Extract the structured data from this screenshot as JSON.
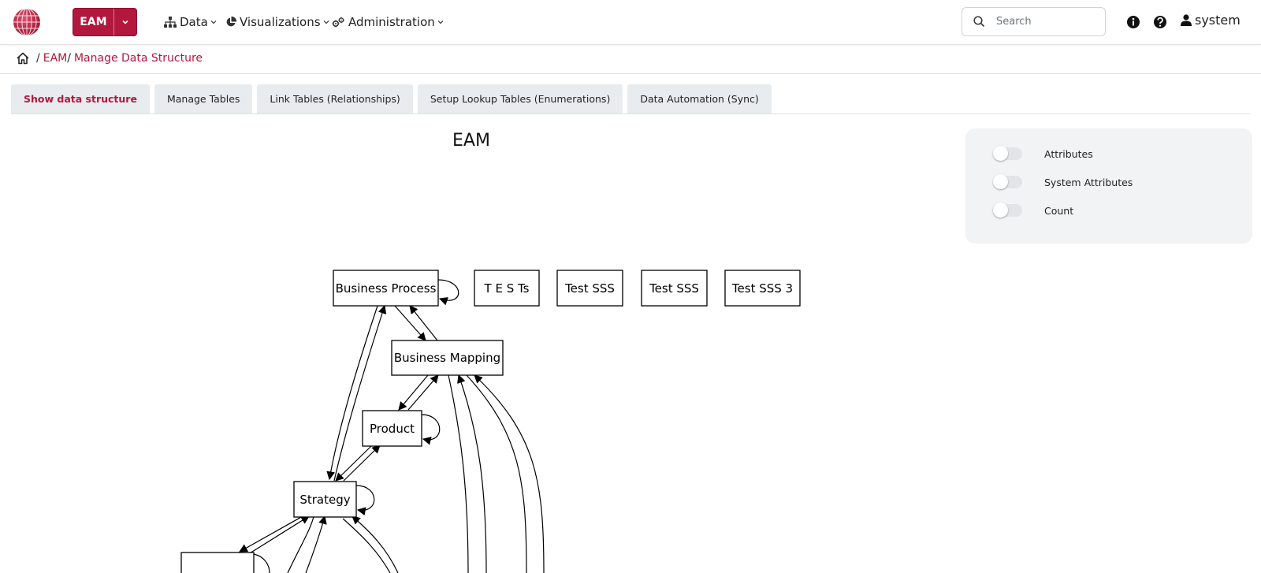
{
  "header": {
    "app_switcher_label": "EAM",
    "menus": [
      {
        "label": "Data"
      },
      {
        "label": "Visualizations"
      },
      {
        "label": "Administration"
      }
    ],
    "search_placeholder": "Search",
    "user_name": "system"
  },
  "breadcrumb": {
    "items": [
      "EAM",
      "Manage Data Structure"
    ]
  },
  "tabs": [
    {
      "label": "Show data structure",
      "active": true
    },
    {
      "label": "Manage Tables",
      "active": false
    },
    {
      "label": "Link Tables (Relationships)",
      "active": false
    },
    {
      "label": "Setup Lookup Tables (Enumerations)",
      "active": false
    },
    {
      "label": "Data Automation (Sync)",
      "active": false
    }
  ],
  "options_panel": {
    "toggles": [
      {
        "label": "Attributes",
        "on": false
      },
      {
        "label": "System Attributes",
        "on": false
      },
      {
        "label": "Count",
        "on": false
      }
    ]
  },
  "graph": {
    "title": "EAM",
    "nodes": [
      {
        "id": "bp",
        "label": "Business Process"
      },
      {
        "id": "tests",
        "label": "T E S Ts"
      },
      {
        "id": "sss1",
        "label": "Test SSS"
      },
      {
        "id": "sss2",
        "label": "Test SSS"
      },
      {
        "id": "sss3",
        "label": "Test SSS 3"
      },
      {
        "id": "bm",
        "label": "Business Mapping"
      },
      {
        "id": "prod",
        "label": "Product"
      },
      {
        "id": "strat",
        "label": "Strategy"
      }
    ]
  },
  "colors": {
    "brand": "#b3173d",
    "tab_bg": "#e9ecef",
    "panel_bg": "#f1f3f5"
  }
}
